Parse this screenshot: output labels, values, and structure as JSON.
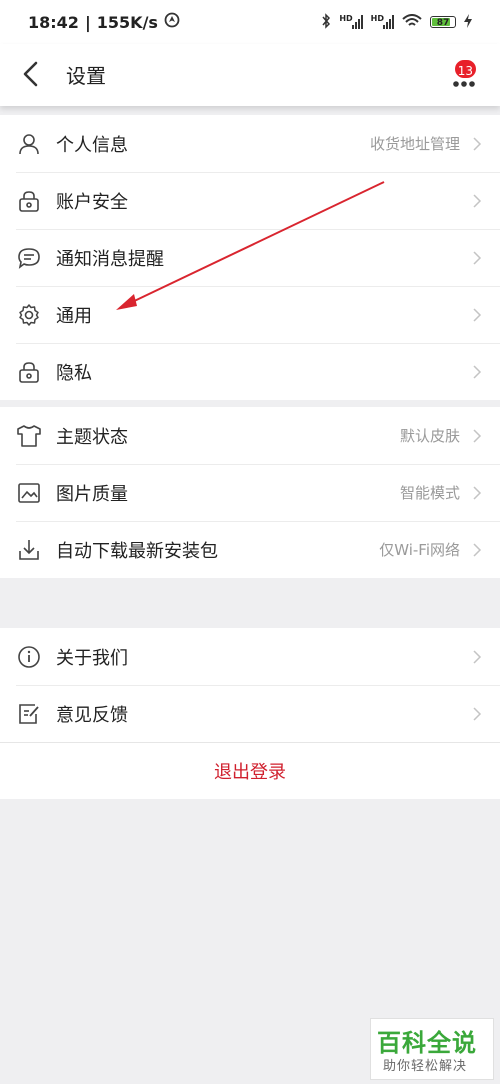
{
  "status_bar": {
    "time": "18:42",
    "speed": "155K/s",
    "hd_label": "HD",
    "battery": "87"
  },
  "header": {
    "title": "设置",
    "badge_count": "13"
  },
  "groups": [
    {
      "items": [
        {
          "label": "个人信息",
          "value": "收货地址管理",
          "icon": "person-icon"
        },
        {
          "label": "账户安全",
          "value": "",
          "icon": "lock-icon"
        },
        {
          "label": "通知消息提醒",
          "value": "",
          "icon": "chat-bubble-icon"
        },
        {
          "label": "通用",
          "value": "",
          "icon": "gear-icon"
        },
        {
          "label": "隐私",
          "value": "",
          "icon": "lock-icon"
        }
      ]
    },
    {
      "items": [
        {
          "label": "主题状态",
          "value": "默认皮肤",
          "icon": "tshirt-icon"
        },
        {
          "label": "图片质量",
          "value": "智能模式",
          "icon": "image-icon"
        },
        {
          "label": "自动下载最新安装包",
          "value": "仅Wi-Fi网络",
          "icon": "download-icon"
        }
      ]
    },
    {
      "items": [
        {
          "label": "关于我们",
          "value": "",
          "icon": "info-icon"
        },
        {
          "label": "意见反馈",
          "value": "",
          "icon": "edit-icon"
        }
      ]
    }
  ],
  "logout_label": "退出登录",
  "watermark": {
    "title": "百科全说",
    "subtitle": "助你轻松解决"
  },
  "colors": {
    "accent_red": "#d0202e",
    "arrow_red": "#d9252f",
    "badge_red": "#e8202a",
    "watermark_green": "#3aa83a"
  }
}
